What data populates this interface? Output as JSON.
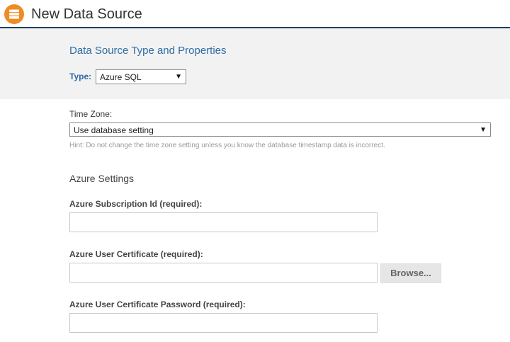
{
  "header": {
    "title": "New Data Source",
    "icon": "database-icon",
    "icon_color": "#f08a24"
  },
  "type_section": {
    "title": "Data Source Type and Properties",
    "type_label": "Type:",
    "type_value": "Azure SQL"
  },
  "time_zone": {
    "label": "Time Zone:",
    "value": "Use database setting",
    "hint": "Hint: Do not change the time zone setting unless you know the database timestamp data is incorrect."
  },
  "azure": {
    "title": "Azure Settings",
    "subscription_label": "Azure Subscription Id (required):",
    "subscription_value": "",
    "certificate_label": "Azure User Certificate (required):",
    "certificate_value": "",
    "browse_label": "Browse...",
    "password_label": "Azure User Certificate Password (required):",
    "password_value": ""
  },
  "colors": {
    "accent_blue": "#2e6ca4",
    "header_border": "#1f3f63",
    "band_background": "#f2f2f2"
  }
}
